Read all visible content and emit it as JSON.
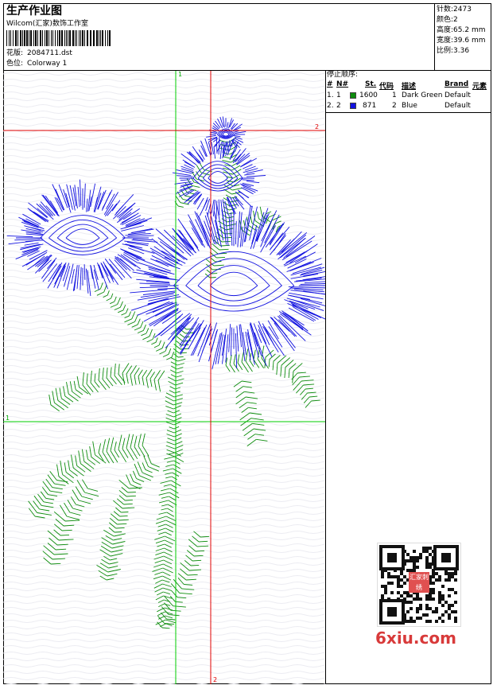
{
  "header": {
    "title": "生产作业图",
    "studio": "Wilcom(汇家)数饰工作室",
    "design_file_label": "花版:",
    "design_file": "2084711.dst",
    "colorway_label": "色位:",
    "colorway": "Colorway 1"
  },
  "stats": [
    {
      "label": "针数:",
      "value": "2473"
    },
    {
      "label": "颜色:",
      "value": "2"
    },
    {
      "label": "高度:",
      "value": "65.2 mm"
    },
    {
      "label": "宽度:",
      "value": "39.6 mm"
    },
    {
      "label": "比例:",
      "value": "3.36"
    }
  ],
  "stop_sequence": {
    "title": "停止顺序:",
    "columns": [
      "#",
      "N#",
      "St.",
      "代码",
      "描述",
      "Brand",
      "元素"
    ],
    "rows": [
      {
        "index": "1.",
        "n": "1",
        "color": "#0d8c0d",
        "stitches": "1600",
        "code": "1",
        "description": "Dark Green",
        "brand": "Default"
      },
      {
        "index": "2.",
        "n": "2",
        "color": "#1212e0",
        "stitches": "871",
        "code": "2",
        "description": "Blue",
        "brand": "Default"
      }
    ]
  },
  "guides": {
    "vertical_green": "1",
    "horizontal_green": "1",
    "horizontal_red": "2",
    "vertical_red": "2"
  },
  "watermark": {
    "text": "6xiu.com",
    "qr_center": "汇家刺绣"
  },
  "colors": {
    "green": "#0d8c0d",
    "blue": "#1212e0",
    "red": "#e00000",
    "guide_green": "#00cc00"
  }
}
